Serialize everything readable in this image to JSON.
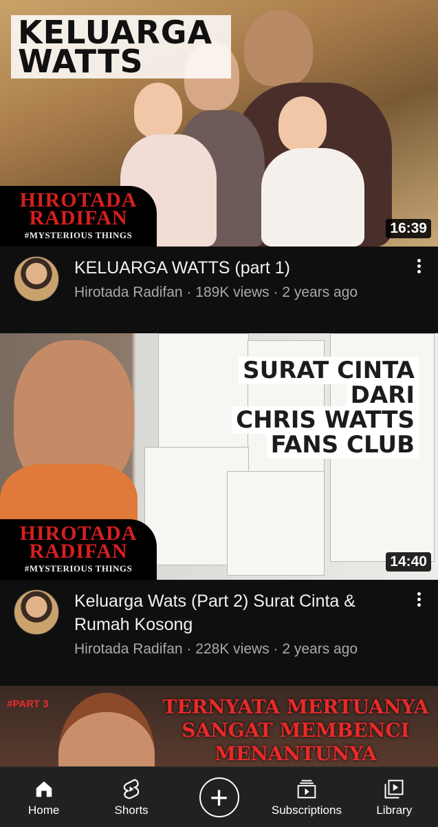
{
  "videos": [
    {
      "thumbnail_text": "KELUARGA WATTS",
      "duration": "16:39",
      "brand": "HIROTADA RADIFAN",
      "brand_sub": "#MYSTERIOUS THINGS",
      "title": "KELUARGA WATTS (part 1)",
      "channel": "Hirotada Radifan",
      "views": "189K views",
      "age": "2 years ago"
    },
    {
      "thumbnail_text_lines": [
        "SURAT CINTA",
        "DARI",
        "CHRIS WATTS",
        "FANS CLUB"
      ],
      "duration": "14:40",
      "brand": "HIROTADA RADIFAN",
      "brand_sub": "#MYSTERIOUS THINGS",
      "title": "Keluarga Wats (Part 2) Surat Cinta & Rumah Kosong",
      "channel": "Hirotada Radifan",
      "views": "228K views",
      "age": "2 years ago"
    },
    {
      "thumbnail_tag": "#PART 3",
      "thumbnail_text": "TERNYATA MERTUANYA SANGAT MEMBENCI MENANTUNYA"
    }
  ],
  "nav": {
    "home": "Home",
    "shorts": "Shorts",
    "subscriptions": "Subscriptions",
    "library": "Library"
  },
  "colors": {
    "background": "#0f0f0f",
    "nav_background": "#212121",
    "brand_red": "#d61f1f"
  }
}
